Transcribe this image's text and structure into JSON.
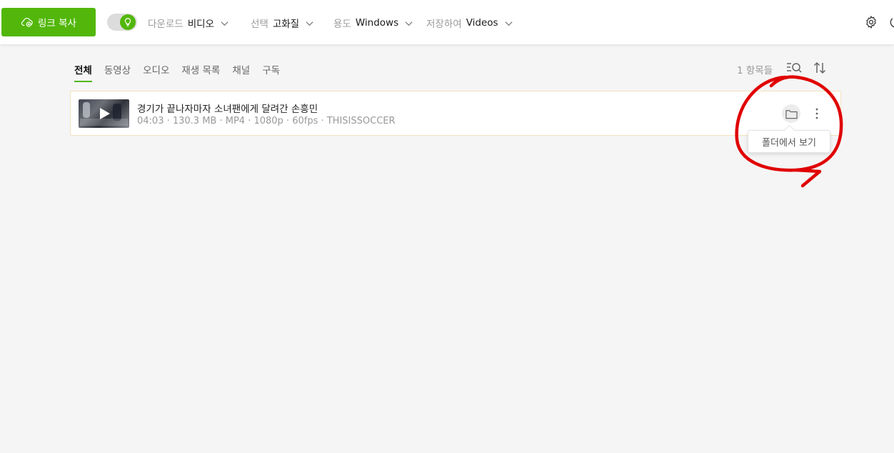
{
  "toolbar": {
    "copy_link_label": "링크 복사",
    "smart_mode_on": true,
    "download": {
      "label": "다운로드",
      "value": "비디오"
    },
    "quality": {
      "label": "선택",
      "value": "고화질"
    },
    "for": {
      "label": "용도",
      "value": "Windows"
    },
    "save_to": {
      "label": "저장하여",
      "value": "Videos"
    }
  },
  "tabs": [
    {
      "label": "전체",
      "active": true
    },
    {
      "label": "동영상"
    },
    {
      "label": "오디오"
    },
    {
      "label": "재생 목록"
    },
    {
      "label": "채널"
    },
    {
      "label": "구독"
    }
  ],
  "list_header": {
    "count_text": "1 항목들"
  },
  "items": [
    {
      "title": "경기가 끝나자마자 소녀팬에게 달려간 손흥민",
      "meta": "04:03 · 130.3 MB · MP4 · 1080p · 60fps · THISISSOCCER",
      "thumbnail_icon": "video-thumbnail",
      "actions": {
        "folder_tooltip": "폴더에서 보기"
      }
    }
  ],
  "colors": {
    "accent": "#52b70a",
    "background": "#f5f5f5",
    "row_border": "#f3e2bd",
    "annotation": "#e00000"
  },
  "icons": {
    "copy": "cloud-plus-icon",
    "toggle": "lightbulb-icon",
    "chevron": "chevron-down-icon",
    "settings": "gear-icon",
    "power": "power-icon",
    "filter": "filter-search-icon",
    "sort": "sort-icon",
    "folder": "folder-icon",
    "more": "more-vertical-icon"
  }
}
